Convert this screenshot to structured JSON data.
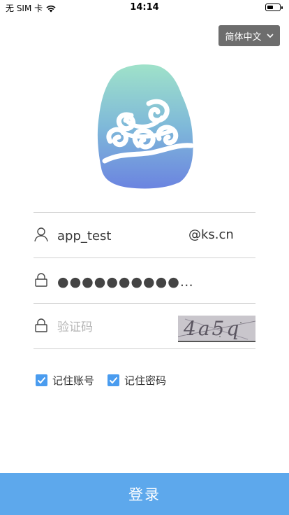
{
  "status_bar": {
    "carrier": "无 SIM 卡",
    "time": "14:14",
    "wifi_icon": "wifi-icon",
    "battery_icon": "battery-icon"
  },
  "language": {
    "label": "简体中文",
    "icon": "chevron-down-icon"
  },
  "logo": {
    "icon": "cloud-seal-logo",
    "colors": [
      "#8fdcc6",
      "#6a8be0"
    ]
  },
  "form": {
    "username": {
      "icon": "user-icon",
      "value": "app_test",
      "suffix": "@ks.cn"
    },
    "password": {
      "icon": "lock-icon",
      "value": "●●●●●●●●●●…"
    },
    "captcha": {
      "icon": "lock-icon",
      "placeholder": "验证码",
      "image_text": "4a5q"
    }
  },
  "options": {
    "remember_account": {
      "label": "记住账号",
      "checked": true
    },
    "remember_password": {
      "label": "记住密码",
      "checked": true
    }
  },
  "login_button": {
    "label": "登录"
  },
  "colors": {
    "primary": "#5da8ec",
    "checkbox": "#4a9cef",
    "lang_button_bg": "#6d6d6d",
    "divider": "#d0d0d0"
  }
}
